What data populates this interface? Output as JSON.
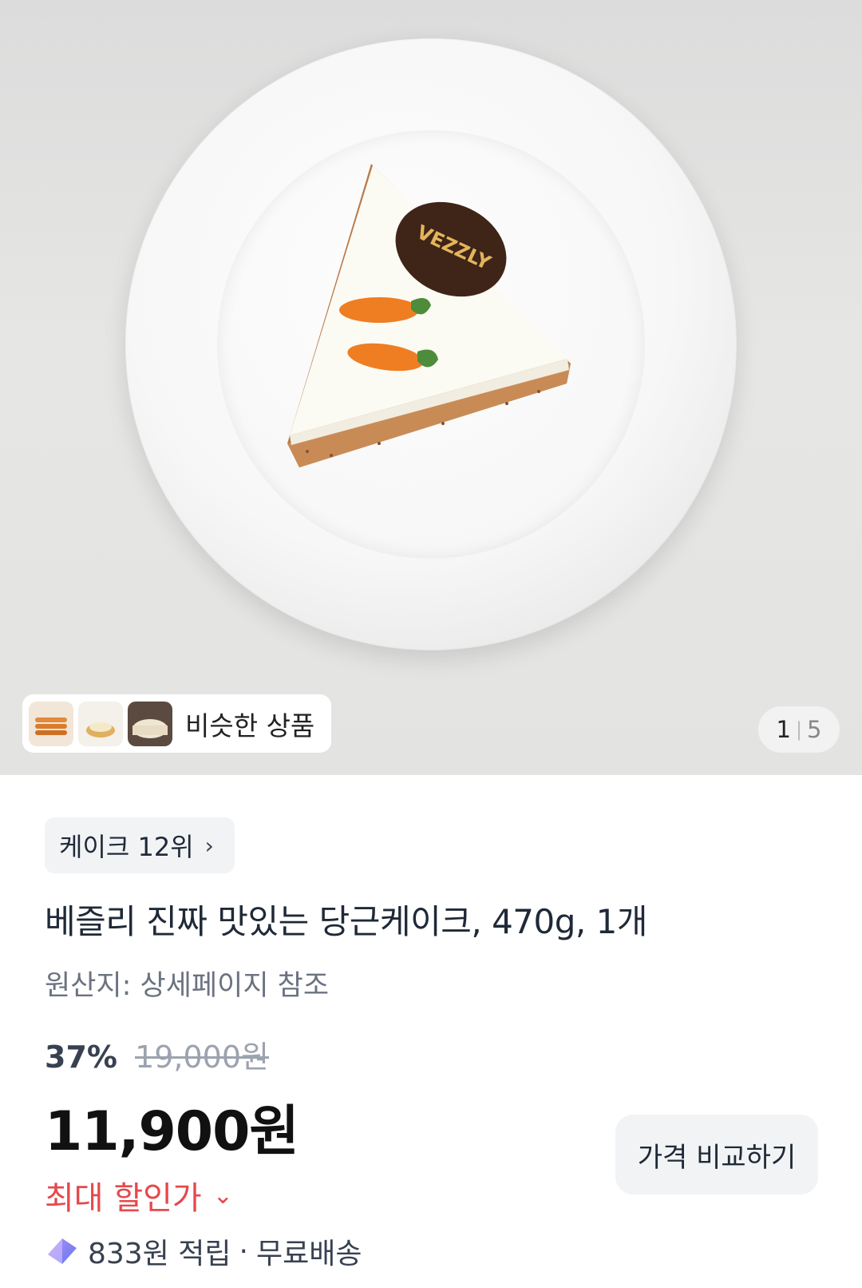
{
  "gallery": {
    "similar_label": "비슷한 상품",
    "counter_current": "1",
    "counter_total": "5",
    "logo_text": "VEZZLY"
  },
  "product": {
    "rank_label": "케이크 12위",
    "title": "베즐리 진짜 맛있는 당근케이크, 470g, 1개",
    "origin": "원산지: 상세페이지 참조",
    "discount_percent": "37%",
    "original_price": "19,000원",
    "price": "11,900원",
    "compare_button": "가격 비교하기",
    "max_discount_label": "최대 할인가",
    "reward": "833원 적립",
    "separator": "·",
    "shipping": "무료배송"
  },
  "colors": {
    "discount_red": "#e5484d",
    "chip_bg": "#f1f3f5"
  }
}
